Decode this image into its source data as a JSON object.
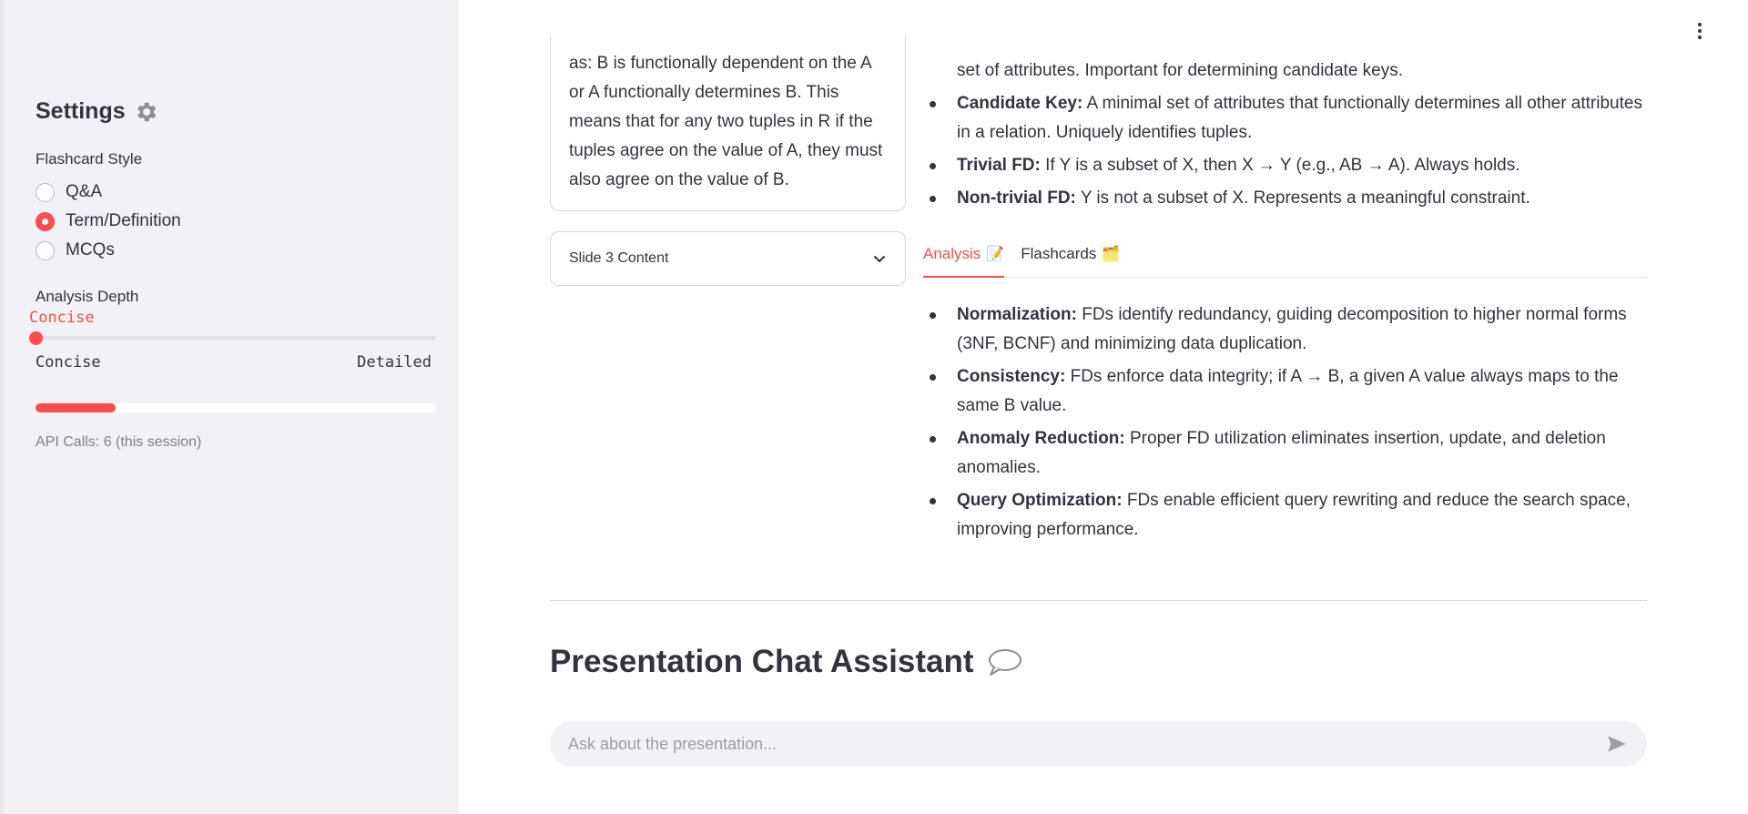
{
  "sidebar": {
    "title": "Settings",
    "flashcard_style": {
      "label": "Flashcard Style",
      "options": [
        "Q&A",
        "Term/Definition",
        "MCQs"
      ],
      "selected": "Term/Definition"
    },
    "analysis_depth": {
      "label": "Analysis Depth",
      "value": "Concise",
      "min_label": "Concise",
      "max_label": "Detailed"
    },
    "api_progress": 0.2,
    "api_calls": "API Calls: 6 (this session)"
  },
  "main": {
    "slide_card_lines": [
      "as: B is functionally dependent on the A",
      "or A functionally determines B. This",
      "means that for any two tuples in R if the",
      "tuples agree on the value of A, they must",
      "also agree on the value of B."
    ],
    "expander_label": "Slide 3 Content",
    "top_bullets": [
      {
        "bold": "",
        "text": "set of attributes. Important for determining candidate keys."
      },
      {
        "bold": "Candidate Key:",
        "text": " A minimal set of attributes that functionally determines all other attributes in a relation. Uniquely identifies tuples."
      },
      {
        "bold": "Trivial FD:",
        "text": " If Y is a subset of X, then X → Y (e.g., AB → A). Always holds."
      },
      {
        "bold": "Non-trivial FD:",
        "text": " Y is not a subset of X. Represents a meaningful constraint."
      }
    ],
    "tabs": [
      {
        "label": "Analysis",
        "emoji": "📝",
        "active": true
      },
      {
        "label": "Flashcards",
        "emoji": "🗂️",
        "active": false
      }
    ],
    "analysis_bullets": [
      {
        "bold": "Normalization:",
        "text": " FDs identify redundancy, guiding decomposition to higher normal forms (3NF, BCNF) and minimizing data duplication."
      },
      {
        "bold": "Consistency:",
        "text": " FDs enforce data integrity; if A → B, a given A value always maps to the same B value."
      },
      {
        "bold": "Anomaly Reduction:",
        "text": " Proper FD utilization eliminates insertion, update, and deletion anomalies."
      },
      {
        "bold": "Query Optimization:",
        "text": " FDs enable efficient query rewriting and reduce the search space, improving performance."
      }
    ],
    "chat": {
      "title": "Presentation Chat Assistant",
      "placeholder": "Ask about the presentation..."
    }
  },
  "colors": {
    "accent": "#ff4b4b",
    "sidebar_bg": "#f0f2f6",
    "text": "#31333f"
  }
}
